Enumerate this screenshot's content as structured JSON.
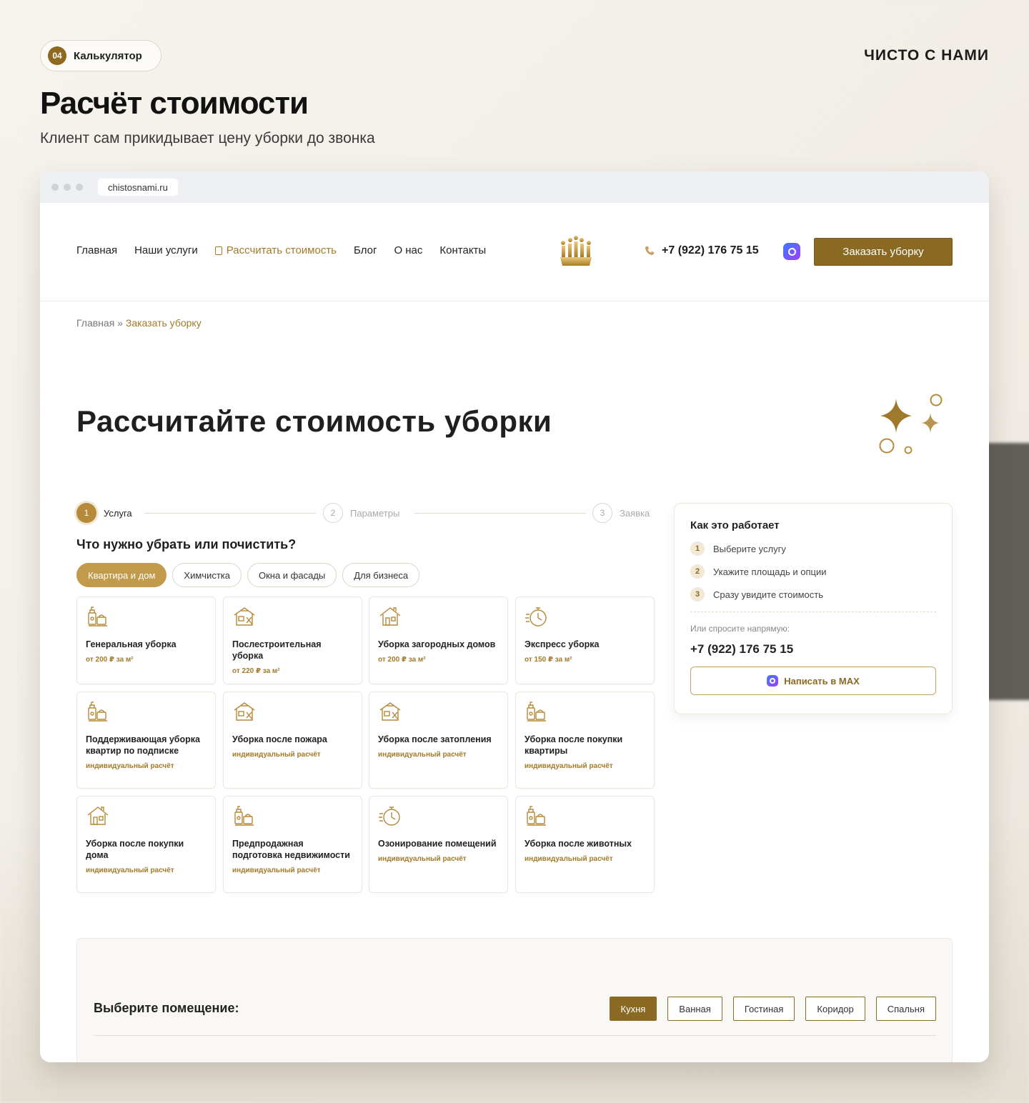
{
  "badge": {
    "num": "04",
    "label": "Калькулятор"
  },
  "brand": "ЧИСТО С НАМИ",
  "hero": {
    "title": "Расчёт стоимости",
    "subtitle": "Клиент сам прикидывает цену уборки до звонка"
  },
  "browser": {
    "url": "chistosnami.ru"
  },
  "nav": {
    "links": [
      "Главная",
      "Наши услуги",
      "Рассчитать стоимость",
      "Блог",
      "О нас",
      "Контакты"
    ],
    "phone": "+7 (922) 176 75 15",
    "order": "Заказать уборку"
  },
  "breadcrumbs": {
    "home": "Главная",
    "sep": " » ",
    "current": "Заказать уборку"
  },
  "page_title": "Рассчитайте стоимость уборки",
  "steps": [
    {
      "num": "1",
      "label": "Услуга"
    },
    {
      "num": "2",
      "label": "Параметры"
    },
    {
      "num": "3",
      "label": "Заявка"
    }
  ],
  "question": "Что нужно убрать или почистить?",
  "pills": [
    "Квартира и дом",
    "Химчистка",
    "Окна и фасады",
    "Для бизнеса"
  ],
  "services": [
    {
      "title": "Генеральная уборка",
      "price": "от 200 ₽ за м²",
      "icon": "cleaning-supplies-icon"
    },
    {
      "title": "Послестроительная уборка",
      "price": "от 220 ₽ за м²",
      "icon": "house-repair-icon"
    },
    {
      "title": "Уборка загородных домов",
      "price": "от 200 ₽ за м²",
      "icon": "house-icon"
    },
    {
      "title": "Экспресс уборка",
      "price": "от 150 ₽ за м²",
      "icon": "stopwatch-icon"
    },
    {
      "title": "Поддерживающая уборка квартир по подписке",
      "price": "индивидуальный расчёт",
      "icon": "cleaning-supplies-icon"
    },
    {
      "title": "Уборка после пожара",
      "price": "индивидуальный расчёт",
      "icon": "house-repair-icon"
    },
    {
      "title": "Уборка после затопления",
      "price": "индивидуальный расчёт",
      "icon": "house-repair-icon"
    },
    {
      "title": "Уборка после покупки квартиры",
      "price": "индивидуальный расчёт",
      "icon": "cleaning-supplies-icon"
    },
    {
      "title": "Уборка после покупки дома",
      "price": "индивидуальный расчёт",
      "icon": "house-icon"
    },
    {
      "title": "Предпродажная подготовка недвижимости",
      "price": "индивидуальный расчёт",
      "icon": "cleaning-supplies-icon"
    },
    {
      "title": "Озонирование помещений",
      "price": "индивидуальный расчёт",
      "icon": "stopwatch-icon"
    },
    {
      "title": "Уборка после животных",
      "price": "индивидуальный расчёт",
      "icon": "cleaning-supplies-icon"
    }
  ],
  "how": {
    "title": "Как это работает",
    "items": [
      {
        "num": "1",
        "text": "Выберите услугу"
      },
      {
        "num": "2",
        "text": "Укажите площадь и опции"
      },
      {
        "num": "3",
        "text": "Сразу увидите стоимость"
      }
    ],
    "ask": "Или спросите напрямую:",
    "phone": "+7 (922) 176 75 15",
    "max_btn": "Написать в MAX"
  },
  "rooms": {
    "title": "Выберите помещение:",
    "options": [
      "Кухня",
      "Ванная",
      "Гостиная",
      "Коридор",
      "Спальня"
    ],
    "selected": "Кухня"
  },
  "colors": {
    "accent": "#8a6a23",
    "gold": "#c29a4c"
  }
}
